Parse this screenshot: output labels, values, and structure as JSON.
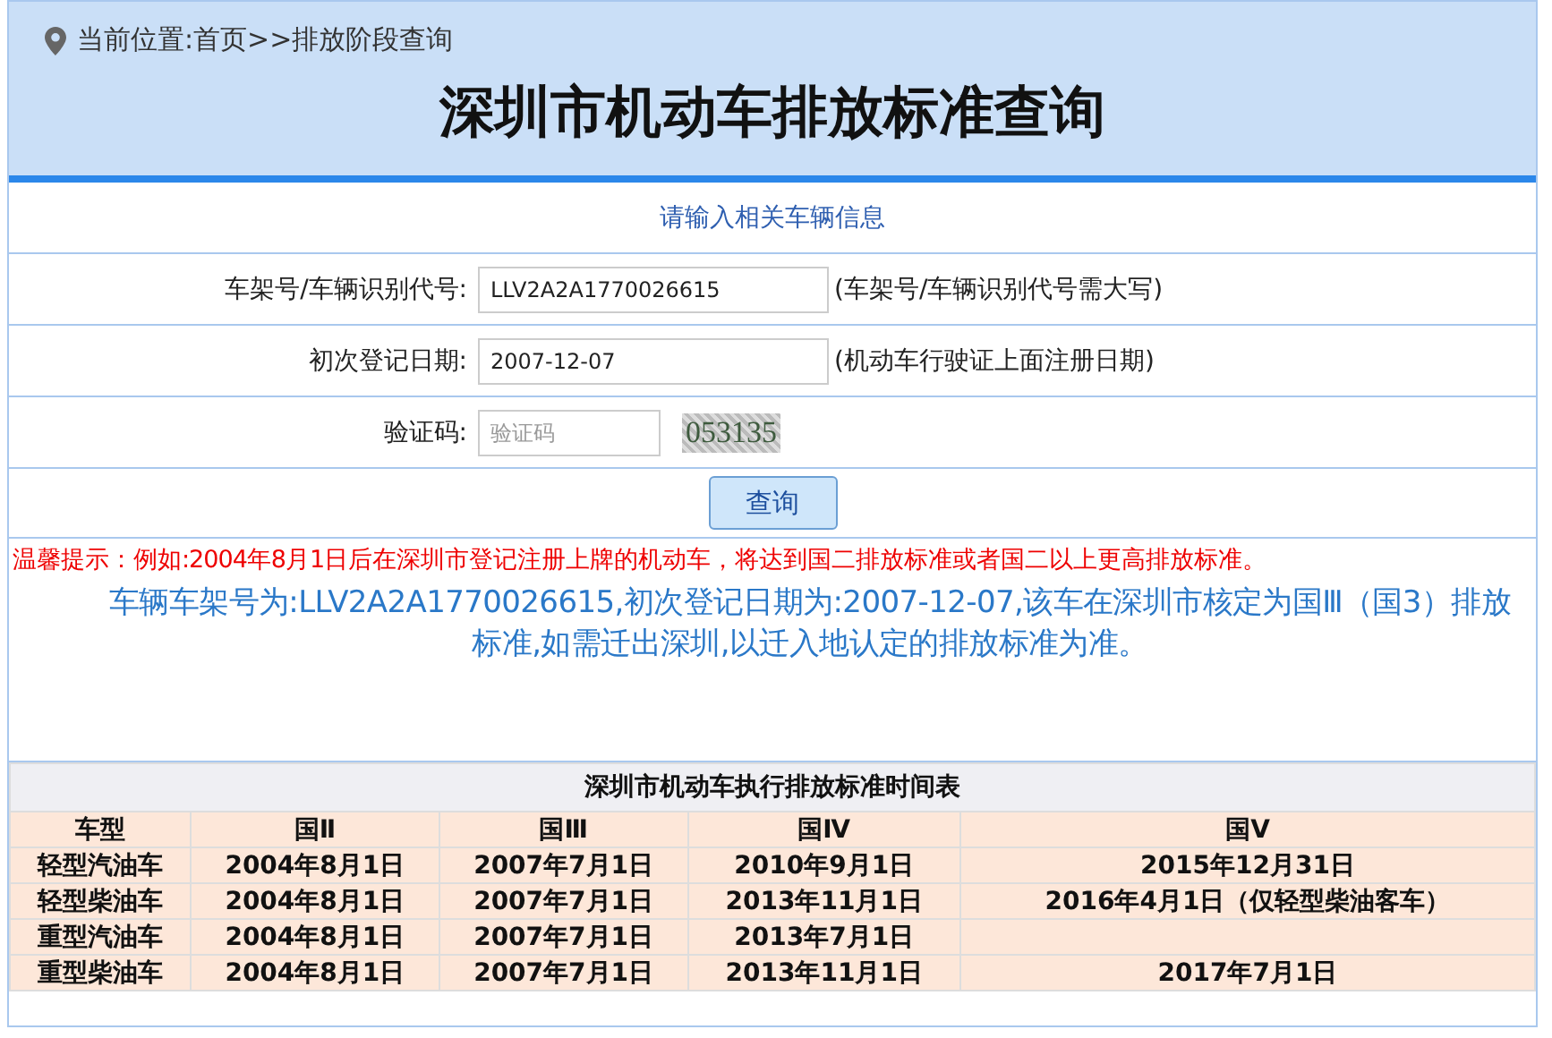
{
  "breadcrumb": "当前位置:首页>>排放阶段查询",
  "title": "深圳市机动车排放标准查询",
  "form": {
    "prompt": "请输入相关车辆信息",
    "fields": [
      {
        "label": "车架号/车辆识别代号:",
        "value": "LLV2A2A1770026615",
        "hint": "(车架号/车辆识别代号需大写)"
      },
      {
        "label": "初次登记日期:",
        "value": "2007-12-07",
        "hint": "(机动车行驶证上面注册日期)"
      }
    ],
    "captcha": {
      "label": "验证码:",
      "placeholder": "验证码",
      "code": "053135"
    },
    "submit": "查询"
  },
  "tip": "温馨提示：例如:2004年8月1日后在深圳市登记注册上牌的机动车，将达到国二排放标准或者国二以上更高排放标准。",
  "result": "车辆车架号为:LLV2A2A1770026615,初次登记日期为:2007-12-07,该车在深圳市核定为国Ⅲ（国3）排放标准,如需迁出深圳,以迁入地认定的排放标准为准。",
  "table": {
    "caption": "深圳市机动车执行排放标准时间表",
    "columns": [
      "车型",
      "国Ⅱ",
      "国Ⅲ",
      "国Ⅳ",
      "国Ⅴ"
    ],
    "rows": [
      [
        "轻型汽油车",
        "2004年8月1日",
        "2007年7月1日",
        "2010年9月1日",
        "2015年12月31日"
      ],
      [
        "轻型柴油车",
        "2004年8月1日",
        "2007年7月1日",
        "2013年11月1日",
        "2016年4月1日（仅轻型柴油客车）"
      ],
      [
        "重型汽油车",
        "2004年8月1日",
        "2007年7月1日",
        "2013年7月1日",
        ""
      ],
      [
        "重型柴油车",
        "2004年8月1日",
        "2007年7月1日",
        "2013年11月1日",
        "2017年7月1日"
      ]
    ]
  }
}
